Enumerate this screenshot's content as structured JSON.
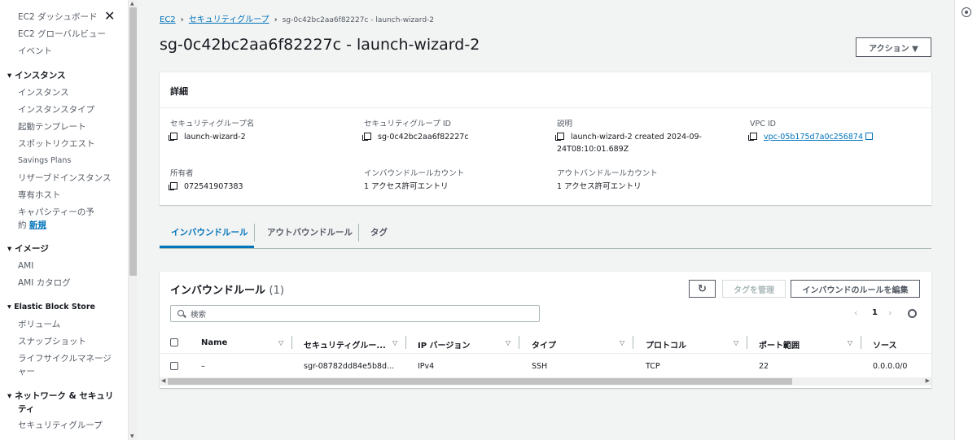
{
  "sidebar": {
    "items": [
      {
        "label": "EC2 ダッシュボード"
      },
      {
        "label": "EC2 グローバルビュー"
      },
      {
        "label": "イベント"
      },
      {
        "label": "インスタンス",
        "section": true
      },
      {
        "label": "インスタンス"
      },
      {
        "label": "インスタンスタイプ"
      },
      {
        "label": "起動テンプレート"
      },
      {
        "label": "スポットリクエスト"
      },
      {
        "label": "Savings Plans"
      },
      {
        "label": "リザーブドインスタンス"
      },
      {
        "label": "専有ホスト"
      },
      {
        "label": "キャパシティーの予"
      },
      {
        "label": "約"
      },
      {
        "label": "イメージ",
        "section": true
      },
      {
        "label": "AMI"
      },
      {
        "label": "AMI カタログ"
      },
      {
        "label": "Elastic Block Store",
        "section": true
      },
      {
        "label": "ボリューム"
      },
      {
        "label": "スナップショット"
      },
      {
        "label": "ライフサイクルマネージ"
      },
      {
        "label": "ャー"
      },
      {
        "label": "ネットワーク & セキュリ",
        "section": true
      },
      {
        "label": "ティ",
        "section": true
      },
      {
        "label": "セキュリティグループ"
      }
    ],
    "new_badge": "新規",
    "close_icon": "✕"
  },
  "breadcrumb": {
    "ec2": "EC2",
    "security_groups": "セキュリティグループ",
    "current": "sg-0c42bc2aa6f82227c - launch-wizard-2"
  },
  "page_title": "sg-0c42bc2aa6f82227c - launch-wizard-2",
  "actions_button": "アクション ▼",
  "details": {
    "header": "詳細",
    "sg_name_label": "セキュリティグループ名",
    "sg_name_value": "launch-wizard-2",
    "sg_id_label": "セキュリティグループ ID",
    "sg_id_value": "sg-0c42bc2aa6f82227c",
    "description_label": "説明",
    "description_line1": "launch-wizard-2 created 2024-09-",
    "description_line2": "24T08:10:01.689Z",
    "vpc_label": "VPC ID",
    "vpc_value": "vpc-05b175d7a0c256874",
    "owner_label": "所有者",
    "owner_value": "072541907383",
    "inbound_count_label": "インバウンドルールカウント",
    "inbound_count_value": "1 アクセス許可エントリ",
    "outbound_count_label": "アウトバンドルールカウント",
    "outbound_count_value": "1 アクセス許可エントリ"
  },
  "tabs": [
    {
      "label": "インバウンドルール",
      "active": true
    },
    {
      "label": "アウトバウンドルール"
    },
    {
      "label": "タグ"
    }
  ],
  "rules": {
    "title": "インバウンドルール",
    "count": "(1)",
    "manage_tags": "タグを管理",
    "edit_rules": "インバウンドのルールを編集",
    "search_placeholder": "検索",
    "page": "1",
    "columns": [
      "Name",
      "セキュリティグルー...",
      "IP バージョン",
      "タイプ",
      "プロトコル",
      "ポート範囲",
      "ソース"
    ],
    "rows": [
      [
        "–",
        "sgr-08782dd84e5b8d...",
        "IPv4",
        "SSH",
        "TCP",
        "22",
        "0.0.0.0/0"
      ]
    ]
  },
  "colors": {
    "link": "#0073bb",
    "text": "#16191f",
    "muted": "#545b64",
    "background": "#f2f3f3"
  }
}
